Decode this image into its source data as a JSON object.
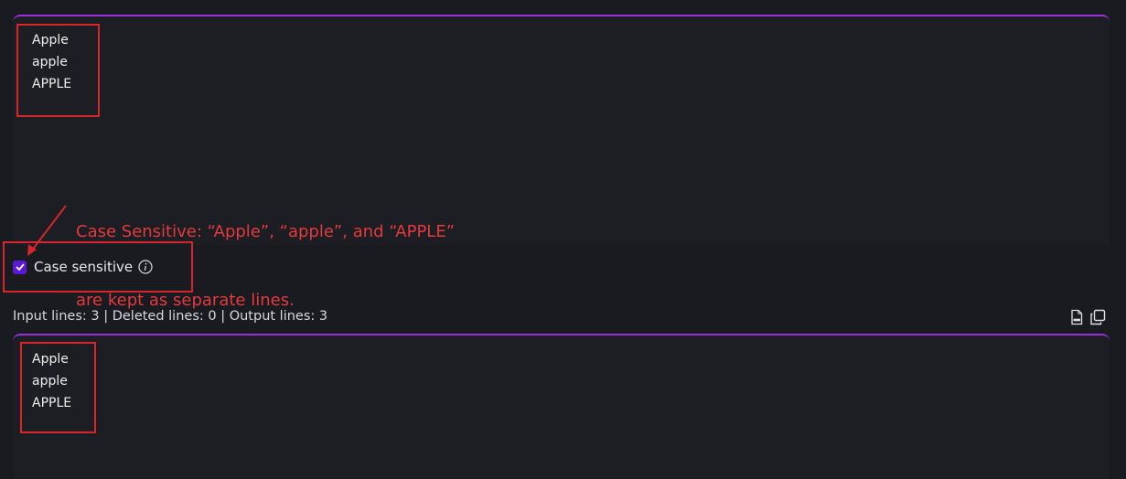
{
  "input_panel": {
    "lines": [
      "Apple",
      "apple",
      "APPLE"
    ]
  },
  "annotation": {
    "line1": "Case Sensitive: “Apple”, “apple”, and “APPLE”",
    "line2": "are kept as separate lines."
  },
  "options": {
    "case_sensitive_label": "Case sensitive",
    "case_sensitive_checked": true
  },
  "stats": {
    "text": "Input lines: 3 | Deleted lines: 0 | Output lines: 3"
  },
  "output_panel": {
    "lines": [
      "Apple",
      "apple",
      "APPLE"
    ]
  },
  "icons": {
    "download": "csv-download-icon",
    "copy": "copy-icon",
    "info": "info-icon",
    "check": "check-icon"
  },
  "colors": {
    "accent": "#9b30e0",
    "checkbox": "#5b18d6",
    "annotation": "#e23a3d",
    "background": "#1a1b20"
  }
}
